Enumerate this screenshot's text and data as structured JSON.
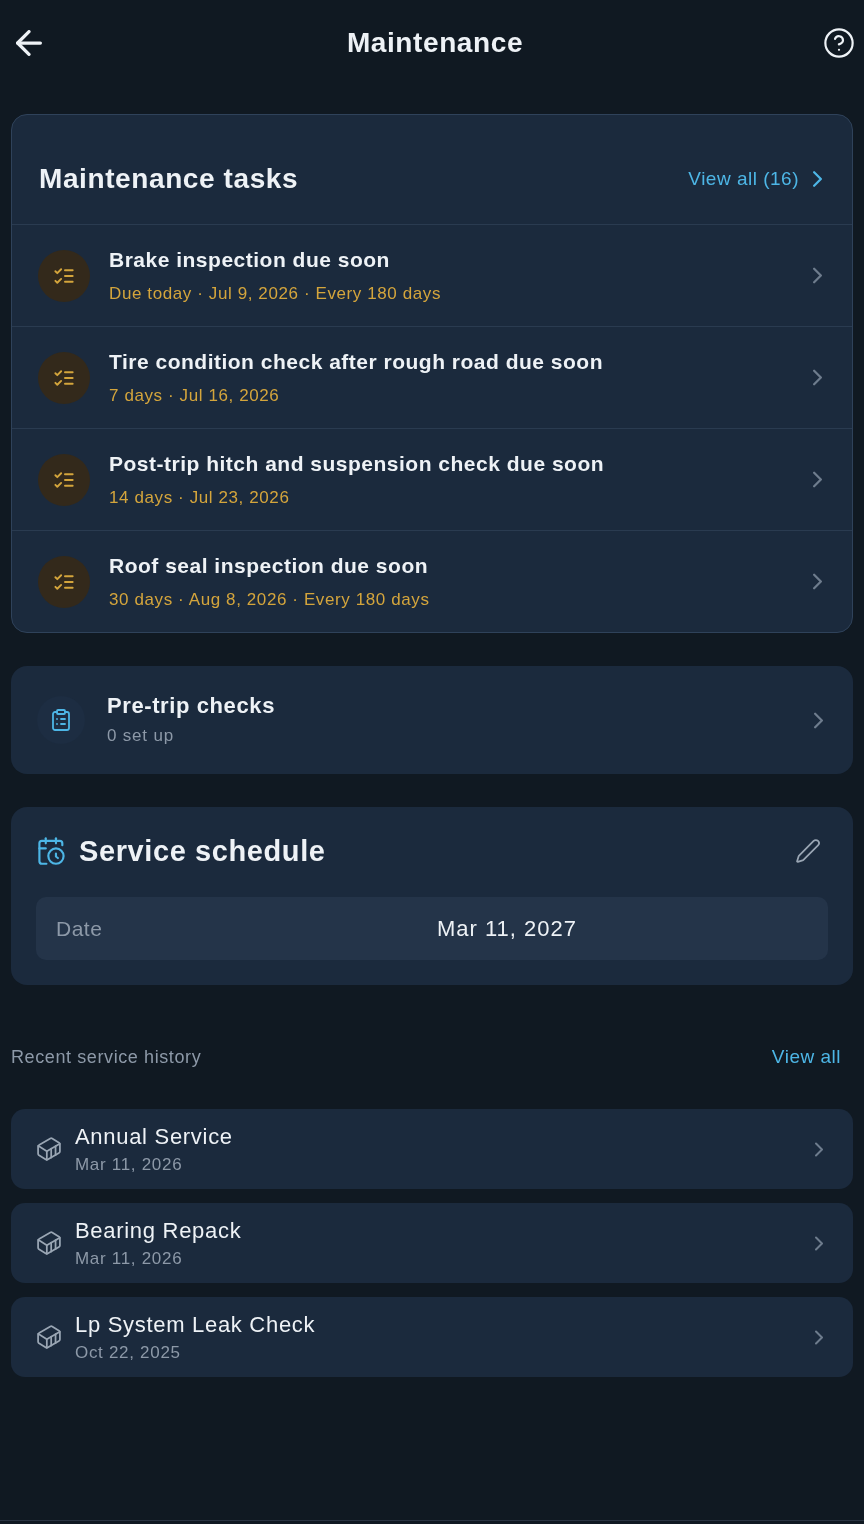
{
  "header": {
    "title": "Maintenance"
  },
  "tasks_card": {
    "title": "Maintenance tasks",
    "view_all": "View all (16)",
    "tasks": [
      {
        "title": "Brake inspection due soon",
        "detail": "Due today · Jul 9, 2026 · Every 180 days"
      },
      {
        "title": "Tire condition check after rough road due soon",
        "detail": "7 days · Jul 16, 2026"
      },
      {
        "title": "Post-trip hitch and suspension check due soon",
        "detail": "14 days · Jul 23, 2026"
      },
      {
        "title": "Roof seal inspection due soon",
        "detail": "30 days · Aug 8, 2026 · Every 180 days"
      }
    ]
  },
  "pre_trip": {
    "title": "Pre-trip checks",
    "subtitle": "0 set up"
  },
  "service_schedule": {
    "title": "Service schedule",
    "field": {
      "label": "Date",
      "value": "Mar 11, 2027"
    }
  },
  "recent_history": {
    "title": "Recent service history",
    "view_all": "View all",
    "items": [
      {
        "title": "Annual Service",
        "date": "Mar 11, 2026"
      },
      {
        "title": "Bearing Repack",
        "date": "Mar 11, 2026"
      },
      {
        "title": "Lp System Leak Check",
        "date": "Oct 22, 2025"
      }
    ]
  }
}
